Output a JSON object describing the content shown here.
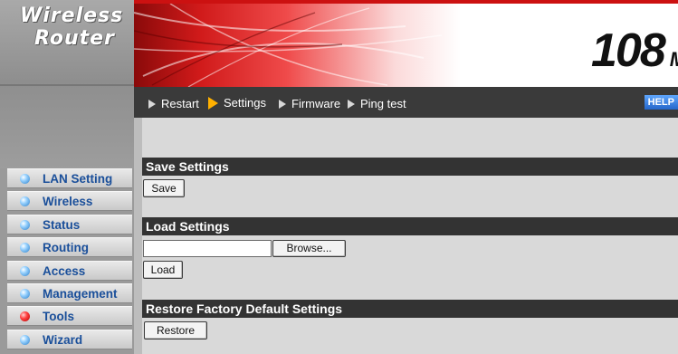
{
  "logo": {
    "line1": "Wireless",
    "line2": "Router"
  },
  "banner": {
    "speed": "108",
    "unit": "Mbps"
  },
  "nav": {
    "items": [
      {
        "label": "Restart"
      },
      {
        "label": "Settings"
      },
      {
        "label": "Firmware"
      },
      {
        "label": "Ping test"
      }
    ],
    "help": "HELP"
  },
  "sidebar": {
    "items": [
      {
        "label": "LAN Setting"
      },
      {
        "label": "Wireless"
      },
      {
        "label": "Status"
      },
      {
        "label": "Routing"
      },
      {
        "label": "Access"
      },
      {
        "label": "Management"
      },
      {
        "label": "Tools"
      },
      {
        "label": "Wizard"
      }
    ]
  },
  "save_section": {
    "title": "Save Settings",
    "button": "Save"
  },
  "load_section": {
    "title": "Load Settings",
    "browse": "Browse...",
    "button": "Load",
    "file_value": ""
  },
  "restore_section": {
    "title": "Restore Factory Default Settings",
    "button": "Restore"
  },
  "colors": {
    "accent_red": "#cc1111",
    "menu_text": "#1a4f9a",
    "header_bar": "#333333"
  }
}
